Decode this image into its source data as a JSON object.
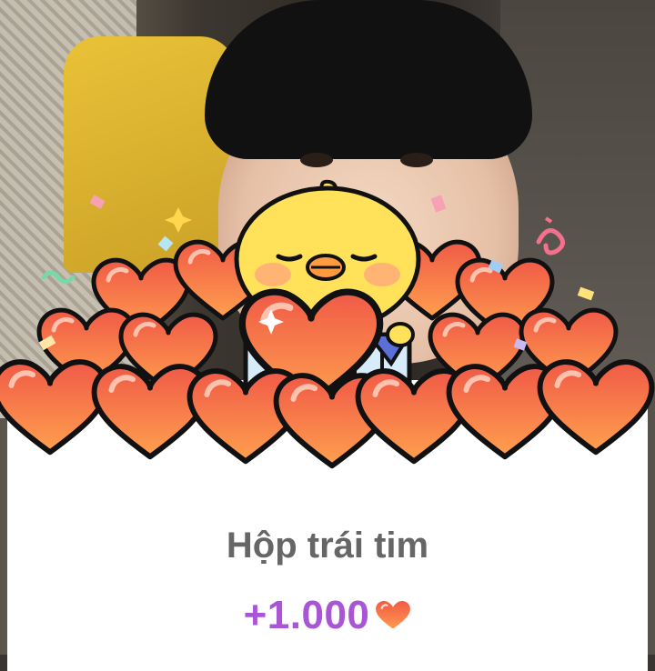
{
  "reward_popup": {
    "title": "Hộp trái tim",
    "amount": "+1.000",
    "reward_icon": "heart-icon",
    "mascot_icon": "chick-mascot-icon",
    "accent_color": "#a855d6",
    "title_color": "#666666",
    "heart_color": "#f25a3a"
  }
}
